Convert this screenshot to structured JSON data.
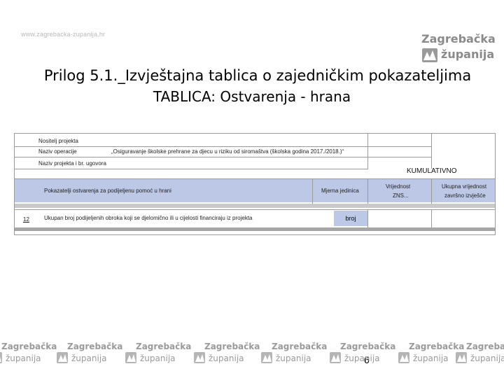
{
  "header": {
    "site_url": "www.zagrebacka-zupanija.hr",
    "logo_line1": "Zagrebačka",
    "logo_line2": "županija"
  },
  "title_line1": "Prilog 5.1._Izvještajna tablica o zajedničkim pokazateljima",
  "title_line2": "TABLICA:   Ostvarenja - hrana",
  "document": {
    "rows": {
      "nositelj_label": "Nositelj projekta",
      "naziv_operacije_label": "Naziv operacije",
      "naziv_operacije_value": "„Osiguravanje školske prehrane za djecu u riziku od siromaštva (školska godina 2017./2018.)“",
      "naziv_projekta_label": "Naziv projekta i br. ugovora"
    },
    "kumulativno": "KUMULATIVNO",
    "header_row": {
      "pokazatelji": "Pokazatelji ostvarenja za podijeljenu pomoć u hrani",
      "mjerna_jedinica": "Mjerna jedinica",
      "vrijednost_1": "Vrijednost",
      "vrijednost_2": "ZNS...",
      "ukupna_1": "Ukupna vrijednost",
      "ukupna_2": "završno izvješće"
    },
    "data_row": {
      "code": "12",
      "description": "Ukupan broj podijeljenih obroka koji se djelomično ili u cijelosti financiraju iz projekta",
      "unit": "broj"
    }
  },
  "page_number": "6",
  "footer": {
    "logo_line1": "Zagrebačka",
    "logo_line2": "županija",
    "logo_positions_count": 8
  },
  "colors": {
    "band_blue": "#bdc8e6",
    "logo_gray": "#8a8a8a"
  }
}
